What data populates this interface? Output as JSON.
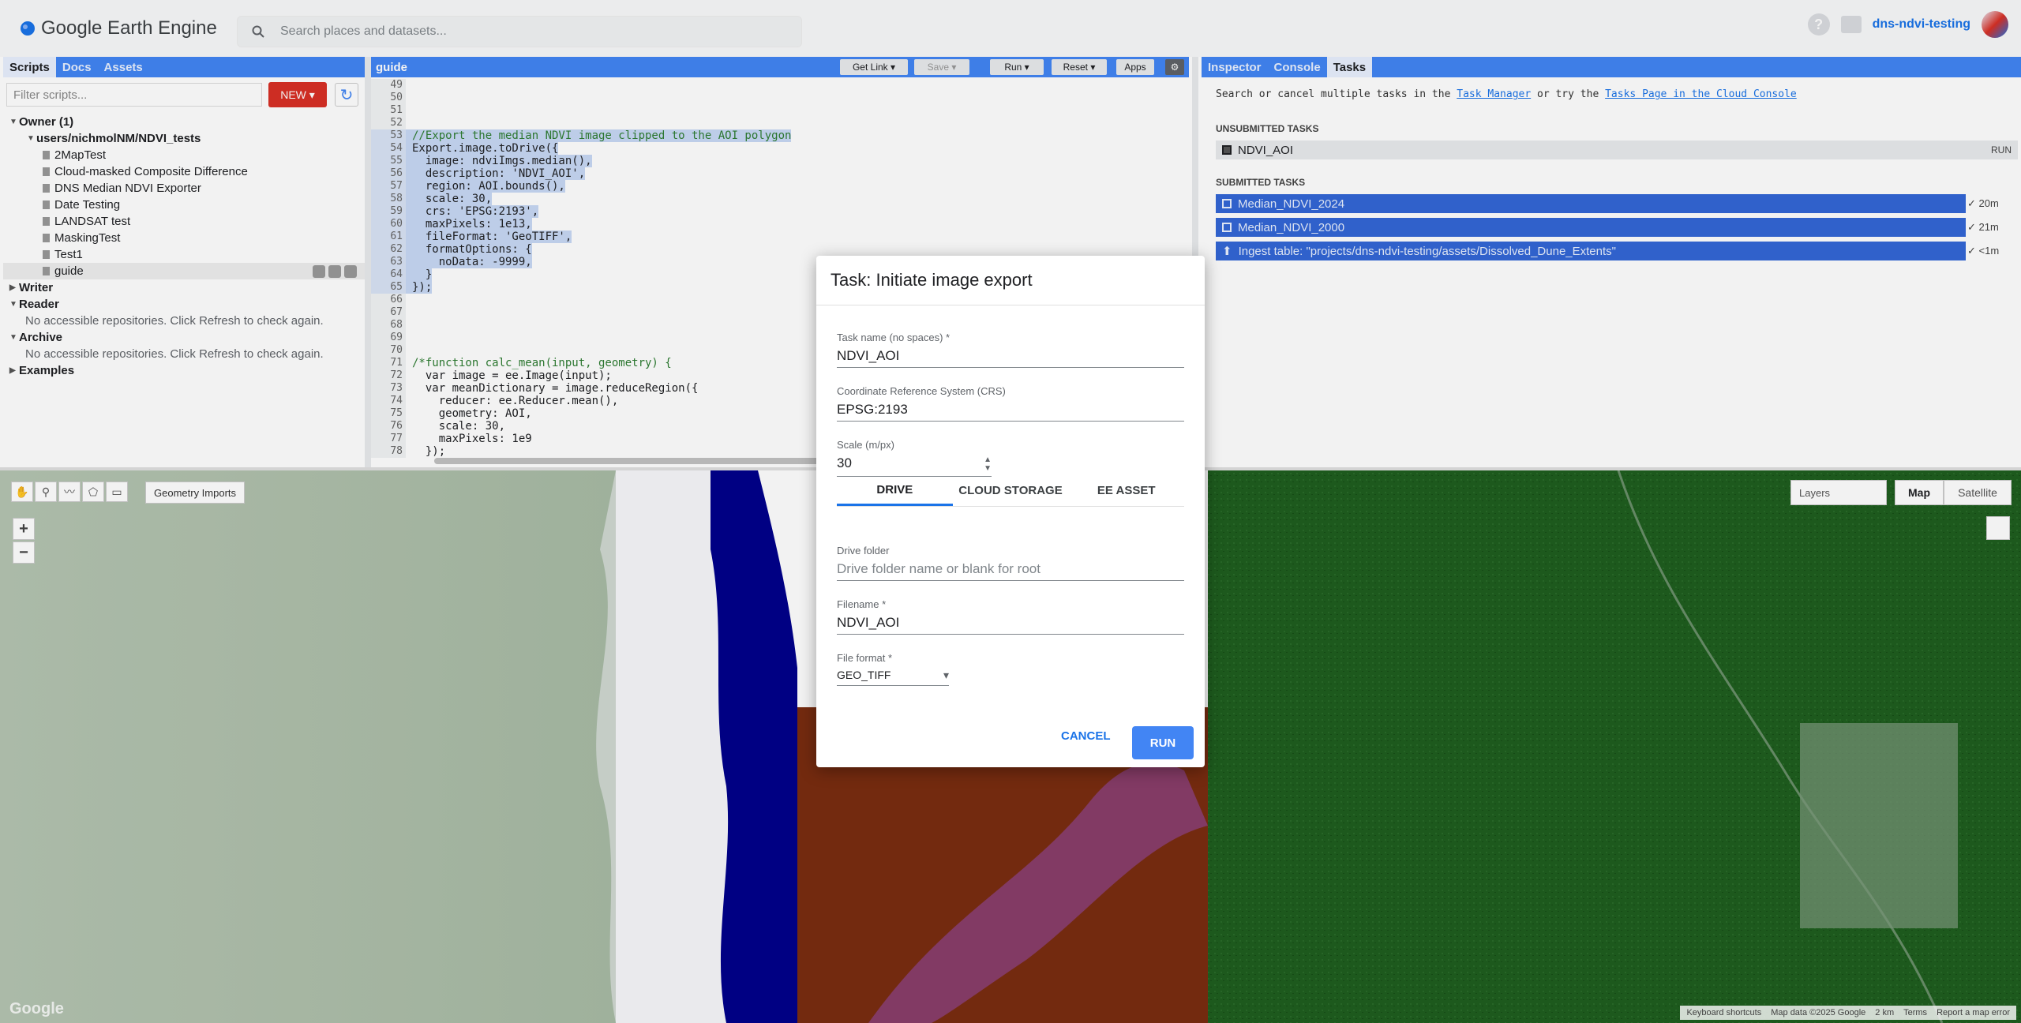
{
  "app": {
    "title": "Google Earth Engine",
    "search_placeholder": "Search places and datasets...",
    "account": "dns-ndvi-testing"
  },
  "left_panel": {
    "tabs": [
      "Scripts",
      "Docs",
      "Assets"
    ],
    "filter_placeholder": "Filter scripts...",
    "new_label": "NEW",
    "tree": {
      "owner": "Owner (1)",
      "repo": "users/nichmolNM/NDVI_tests",
      "files": [
        "2MapTest",
        "Cloud-masked Composite Difference",
        "DNS Median NDVI Exporter",
        "Date Testing",
        "LANDSAT test",
        "MaskingTest",
        "Test1",
        "guide"
      ],
      "writer": "Writer",
      "reader": "Reader",
      "reader_msg": "No accessible repositories. Click Refresh to check again.",
      "archive": "Archive",
      "archive_msg": "No accessible repositories. Click Refresh to check again.",
      "examples": "Examples"
    }
  },
  "editor": {
    "title": "guide",
    "buttons": {
      "get_link": "Get Link",
      "save": "Save",
      "run": "Run",
      "reset": "Reset",
      "apps": "Apps"
    },
    "lines": [
      {
        "n": "49",
        "t": ""
      },
      {
        "n": "50",
        "t": ""
      },
      {
        "n": "51",
        "t": ""
      },
      {
        "n": "52",
        "t": ""
      },
      {
        "n": "53",
        "t": "//Export the median NDVI image clipped to the AOI polygon"
      },
      {
        "n": "54",
        "t": "Export.image.toDrive({"
      },
      {
        "n": "55",
        "t": "  image: ndviImgs.median(),"
      },
      {
        "n": "56",
        "t": "  description: 'NDVI_AOI',"
      },
      {
        "n": "57",
        "t": "  region: AOI.bounds(),"
      },
      {
        "n": "58",
        "t": "  scale: 30,"
      },
      {
        "n": "59",
        "t": "  crs: 'EPSG:2193',"
      },
      {
        "n": "60",
        "t": "  maxPixels: 1e13,"
      },
      {
        "n": "61",
        "t": "  fileFormat: 'GeoTIFF',"
      },
      {
        "n": "62",
        "t": "  formatOptions: {"
      },
      {
        "n": "63",
        "t": "    noData: -9999,"
      },
      {
        "n": "64",
        "t": "  }"
      },
      {
        "n": "65",
        "t": "});"
      },
      {
        "n": "66",
        "t": ""
      },
      {
        "n": "67",
        "t": ""
      },
      {
        "n": "68",
        "t": ""
      },
      {
        "n": "69",
        "t": ""
      },
      {
        "n": "70",
        "t": ""
      },
      {
        "n": "71",
        "t": "/*function calc_mean(input, geometry) {"
      },
      {
        "n": "72",
        "t": "  var image = ee.Image(input);"
      },
      {
        "n": "73",
        "t": "  var meanDictionary = image.reduceRegion({"
      },
      {
        "n": "74",
        "t": "    reducer: ee.Reducer.mean(),"
      },
      {
        "n": "75",
        "t": "    geometry: AOI,"
      },
      {
        "n": "76",
        "t": "    scale: 30,"
      },
      {
        "n": "77",
        "t": "    maxPixels: 1e9"
      },
      {
        "n": "78",
        "t": "  });"
      }
    ]
  },
  "right_panel": {
    "tabs": [
      "Inspector",
      "Console",
      "Tasks"
    ],
    "intro_a": "Search or cancel multiple tasks in the",
    "intro_link1": "Task Manager",
    "intro_b": "or try the",
    "intro_link2": "Tasks Page in the Cloud Console",
    "unsubmitted_label": "UNSUBMITTED TASKS",
    "unsubmitted": [
      {
        "name": "NDVI_AOI",
        "action": "RUN"
      }
    ],
    "submitted_label": "SUBMITTED TASKS",
    "submitted": [
      {
        "name": "Median_NDVI_2024",
        "time": "20m"
      },
      {
        "name": "Median_NDVI_2000",
        "time": "21m"
      },
      {
        "name": "Ingest table: \"projects/dns-ndvi-testing/assets/Dissolved_Dune_Extents\"",
        "time": "<1m"
      }
    ]
  },
  "map": {
    "geometry_imports": "Geometry Imports",
    "layers": "Layers",
    "map_btn": "Map",
    "satellite_btn": "Satellite",
    "zoom_in": "+",
    "zoom_out": "−",
    "watermark": "Google",
    "footer": [
      "Keyboard shortcuts",
      "Map data ©2025 Google",
      "2 km",
      "Terms",
      "Report a map error"
    ]
  },
  "dialog": {
    "title": "Task: Initiate image export",
    "task_name_label": "Task name (no spaces) *",
    "task_name": "NDVI_AOI",
    "crs_label": "Coordinate Reference System (CRS)",
    "crs": "EPSG:2193",
    "scale_label": "Scale (m/px)",
    "scale": "30",
    "tabs": [
      "DRIVE",
      "CLOUD STORAGE",
      "EE ASSET"
    ],
    "drive_folder_label": "Drive folder",
    "drive_folder_placeholder": "Drive folder name or blank for root",
    "filename_label": "Filename *",
    "filename": "NDVI_AOI",
    "format_label": "File format *",
    "format": "GEO_TIFF",
    "cancel": "CANCEL",
    "run": "RUN"
  },
  "colors": {
    "accent": "#4285f4",
    "new_button": "#d93025",
    "submitted_task": "#3367d6",
    "map_green": "#1e5e1e",
    "map_blue": "#00008b",
    "map_red": "#7a2d10"
  }
}
